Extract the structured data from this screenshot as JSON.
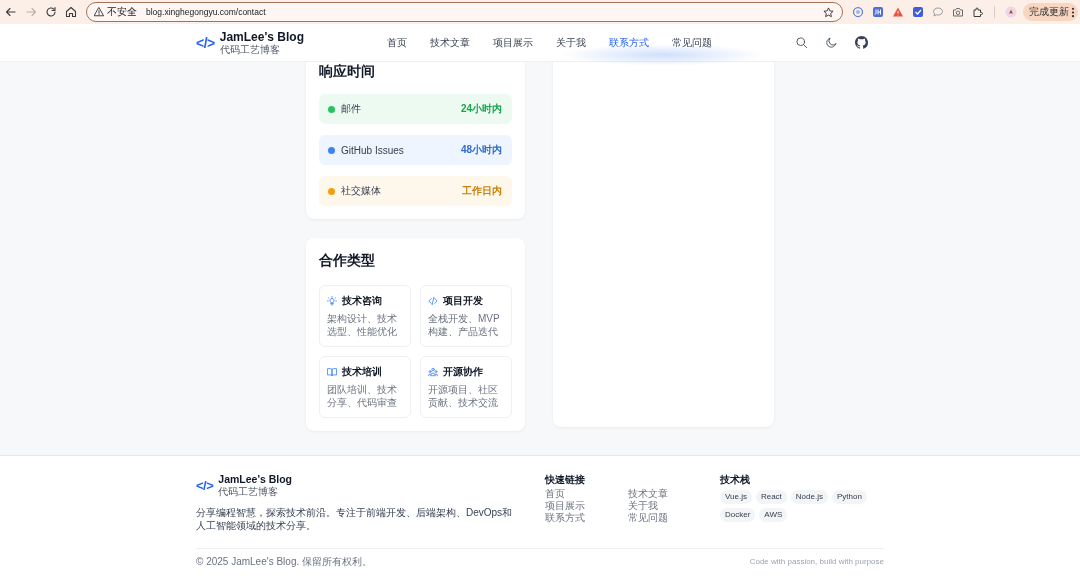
{
  "browser": {
    "security_label": "不安全",
    "url": "blog.xinghegongyu.com/contact",
    "update_button": "完成更新"
  },
  "header": {
    "logo_mark": "</>",
    "title": "JamLee's Blog",
    "subtitle": "代码工艺博客",
    "nav": [
      {
        "label": "首页",
        "selected": false
      },
      {
        "label": "技术文章",
        "selected": false
      },
      {
        "label": "项目展示",
        "selected": false
      },
      {
        "label": "关于我",
        "selected": false
      },
      {
        "label": "联系方式",
        "selected": true
      },
      {
        "label": "常见问题",
        "selected": false
      }
    ]
  },
  "response_time": {
    "title": "响应时间",
    "items": [
      {
        "channel": "邮件",
        "time": "24小时内",
        "color": "#22c55e"
      },
      {
        "channel": "GitHub Issues",
        "time": "48小时内",
        "color": "#3b82f6"
      },
      {
        "channel": "社交媒体",
        "time": "工作日内",
        "color": "#f59e0b"
      }
    ]
  },
  "cooperation": {
    "title": "合作类型",
    "items": [
      {
        "title": "技术咨询",
        "description": "架构设计、技术选型、性能优化"
      },
      {
        "title": "项目开发",
        "description": "全栈开发、MVP构建、产品迭代"
      },
      {
        "title": "技术培训",
        "description": "团队培训、技术分享、代码审查"
      },
      {
        "title": "开源协作",
        "description": "开源项目、社区贡献、技术交流"
      }
    ]
  },
  "footer": {
    "logo_mark": "</>",
    "title": "JamLee's Blog",
    "subtitle": "代码工艺博客",
    "description": "分享编程智慧，探索技术前沿。专注于前端开发、后端架构、DevOps和人工智能领域的技术分享。",
    "quick_links": {
      "title": "快速链接",
      "links": [
        "首页",
        "技术文章",
        "项目展示",
        "关于我",
        "联系方式",
        "常见问题"
      ]
    },
    "tech_stack": {
      "title": "技术栈",
      "tags": [
        "Vue.js",
        "React",
        "Node.js",
        "Python",
        "Docker",
        "AWS"
      ]
    },
    "copyright": "© 2025 JamLee's Blog. 保留所有权利。",
    "slogan": "Code with passion, build with purpose"
  }
}
